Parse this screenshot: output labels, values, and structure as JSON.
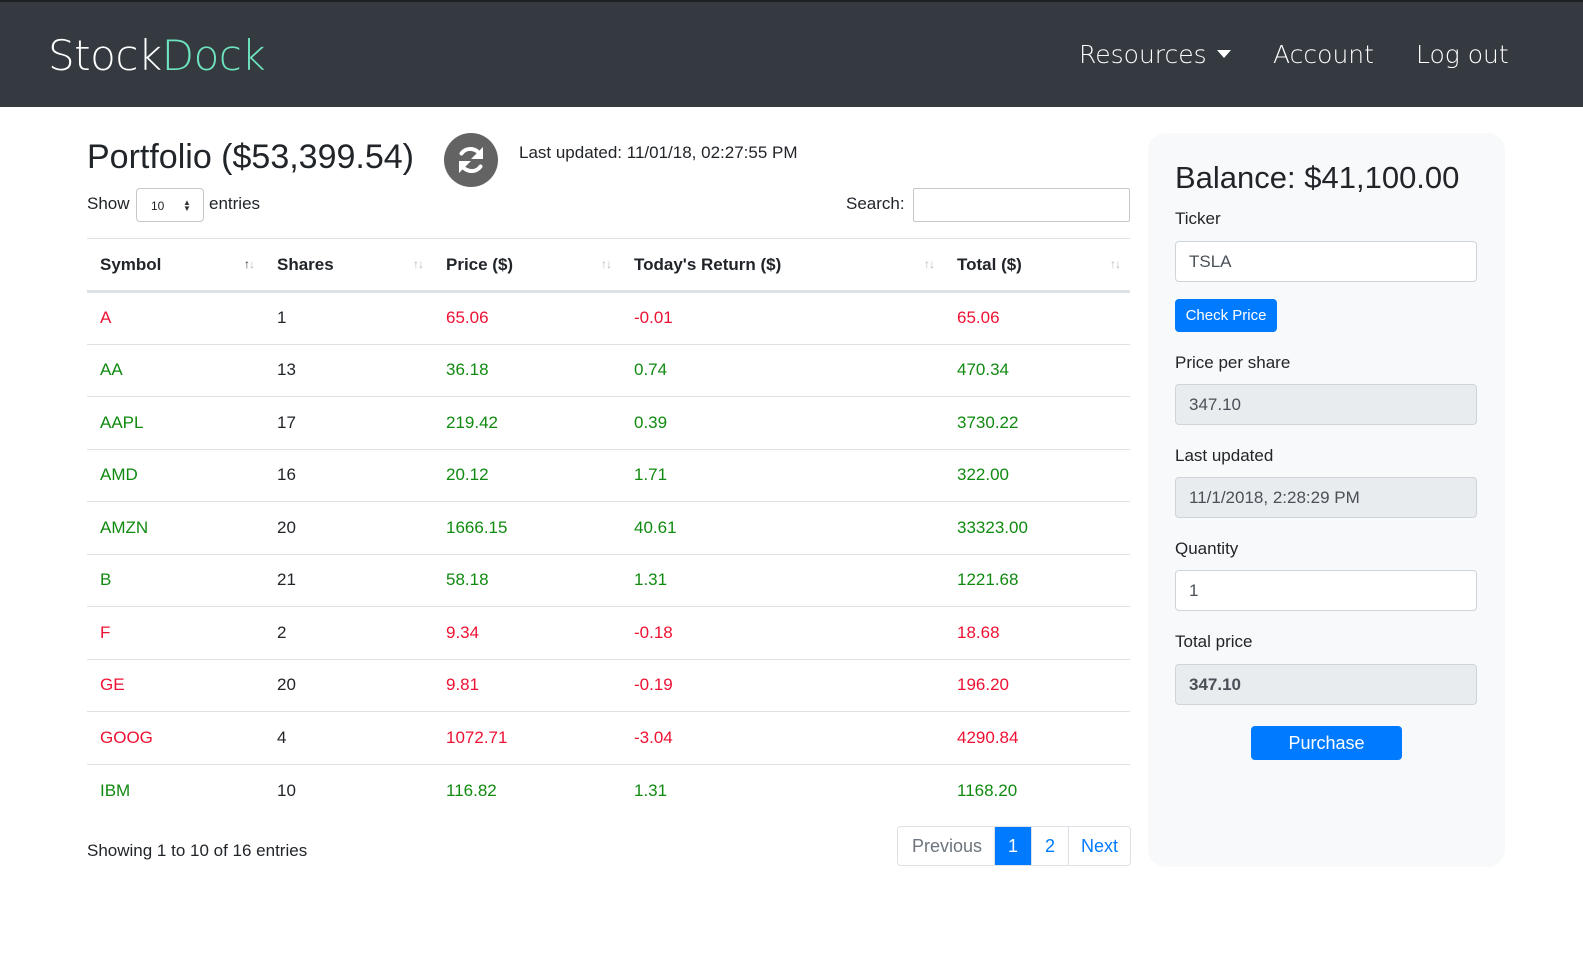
{
  "navbar": {
    "brand_part1": "Stock",
    "brand_part2": "Dock",
    "resources_label": "Resources",
    "account_label": "Account",
    "logout_label": "Log out"
  },
  "portfolio": {
    "title": "Portfolio ($53,399.54)",
    "last_updated": "Last updated: 11/01/18, 02:27:55 PM",
    "refresh_icon": "refresh-icon"
  },
  "table_controls": {
    "show_label": "Show",
    "entries_value": "10",
    "entries_label": "entries",
    "search_label": "Search:",
    "search_value": ""
  },
  "table": {
    "headers": [
      "Symbol",
      "Shares",
      "Price ($)",
      "Today's Return ($)",
      "Total ($)"
    ],
    "rows": [
      {
        "symbol": "A",
        "shares": "1",
        "price": "65.06",
        "return": "-0.01",
        "total": "65.06",
        "trend": "down"
      },
      {
        "symbol": "AA",
        "shares": "13",
        "price": "36.18",
        "return": "0.74",
        "total": "470.34",
        "trend": "up"
      },
      {
        "symbol": "AAPL",
        "shares": "17",
        "price": "219.42",
        "return": "0.39",
        "total": "3730.22",
        "trend": "up"
      },
      {
        "symbol": "AMD",
        "shares": "16",
        "price": "20.12",
        "return": "1.71",
        "total": "322.00",
        "trend": "up"
      },
      {
        "symbol": "AMZN",
        "shares": "20",
        "price": "1666.15",
        "return": "40.61",
        "total": "33323.00",
        "trend": "up"
      },
      {
        "symbol": "B",
        "shares": "21",
        "price": "58.18",
        "return": "1.31",
        "total": "1221.68",
        "trend": "up"
      },
      {
        "symbol": "F",
        "shares": "2",
        "price": "9.34",
        "return": "-0.18",
        "total": "18.68",
        "trend": "down"
      },
      {
        "symbol": "GE",
        "shares": "20",
        "price": "9.81",
        "return": "-0.19",
        "total": "196.20",
        "trend": "down"
      },
      {
        "symbol": "GOOG",
        "shares": "4",
        "price": "1072.71",
        "return": "-3.04",
        "total": "4290.84",
        "trend": "down"
      },
      {
        "symbol": "IBM",
        "shares": "10",
        "price": "116.82",
        "return": "1.31",
        "total": "1168.20",
        "trend": "up"
      }
    ]
  },
  "footer": {
    "showing": "Showing 1 to 10 of 16 entries",
    "previous": "Previous",
    "page1": "1",
    "page2": "2",
    "next": "Next"
  },
  "sidebar": {
    "balance": "Balance: $41,100.00",
    "ticker_label": "Ticker",
    "ticker_value": "TSLA",
    "check_price_label": "Check Price",
    "price_label": "Price per share",
    "price_value": "347.10",
    "updated_label": "Last updated",
    "updated_value": "11/1/2018, 2:28:29 PM",
    "quantity_label": "Quantity",
    "quantity_value": "1",
    "total_label": "Total price",
    "total_value": "347.10",
    "purchase_label": "Purchase"
  },
  "colors": {
    "navbar": "#343a40",
    "brand_accent": "#6ee4c1",
    "primary": "#007bff",
    "gain": "#108a10",
    "loss": "#ee1133"
  }
}
